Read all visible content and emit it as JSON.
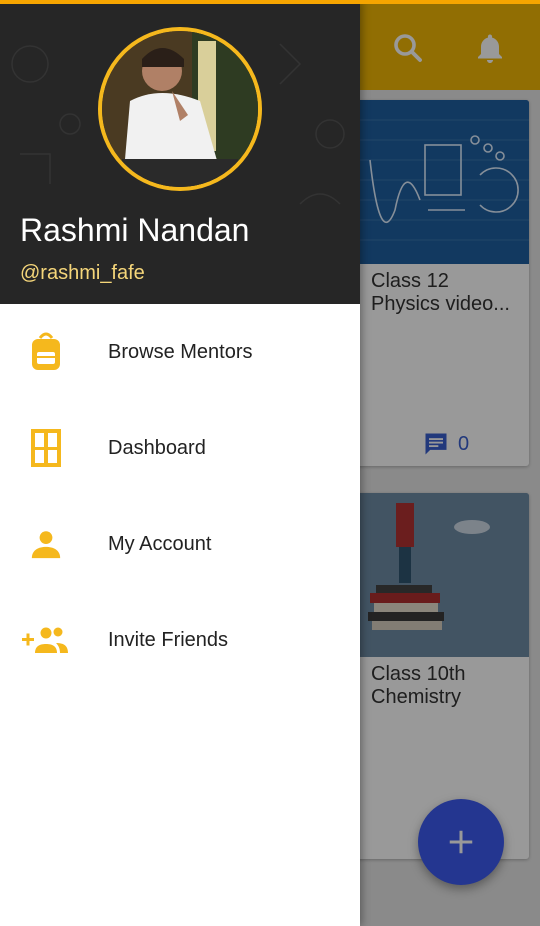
{
  "drawer": {
    "user_name": "Rashmi Nandan",
    "user_handle": "@rashmi_fafe",
    "menu": [
      {
        "label": "Browse Mentors",
        "icon": "backpack-icon"
      },
      {
        "label": "Dashboard",
        "icon": "dashboard-grid-icon"
      },
      {
        "label": "My Account",
        "icon": "person-icon"
      },
      {
        "label": "Invite Friends",
        "icon": "add-people-icon"
      }
    ]
  },
  "background": {
    "cards": [
      {
        "title_line1": "Class 12",
        "title_line2": "Physics video...",
        "comment_count": "0"
      },
      {
        "title_line1": "Class 10th",
        "title_line2": "Chemistry"
      }
    ]
  },
  "colors": {
    "accent": "#f5b81d",
    "header": "#262626",
    "fab": "#3d5af1",
    "comment": "#3a5fcf"
  }
}
